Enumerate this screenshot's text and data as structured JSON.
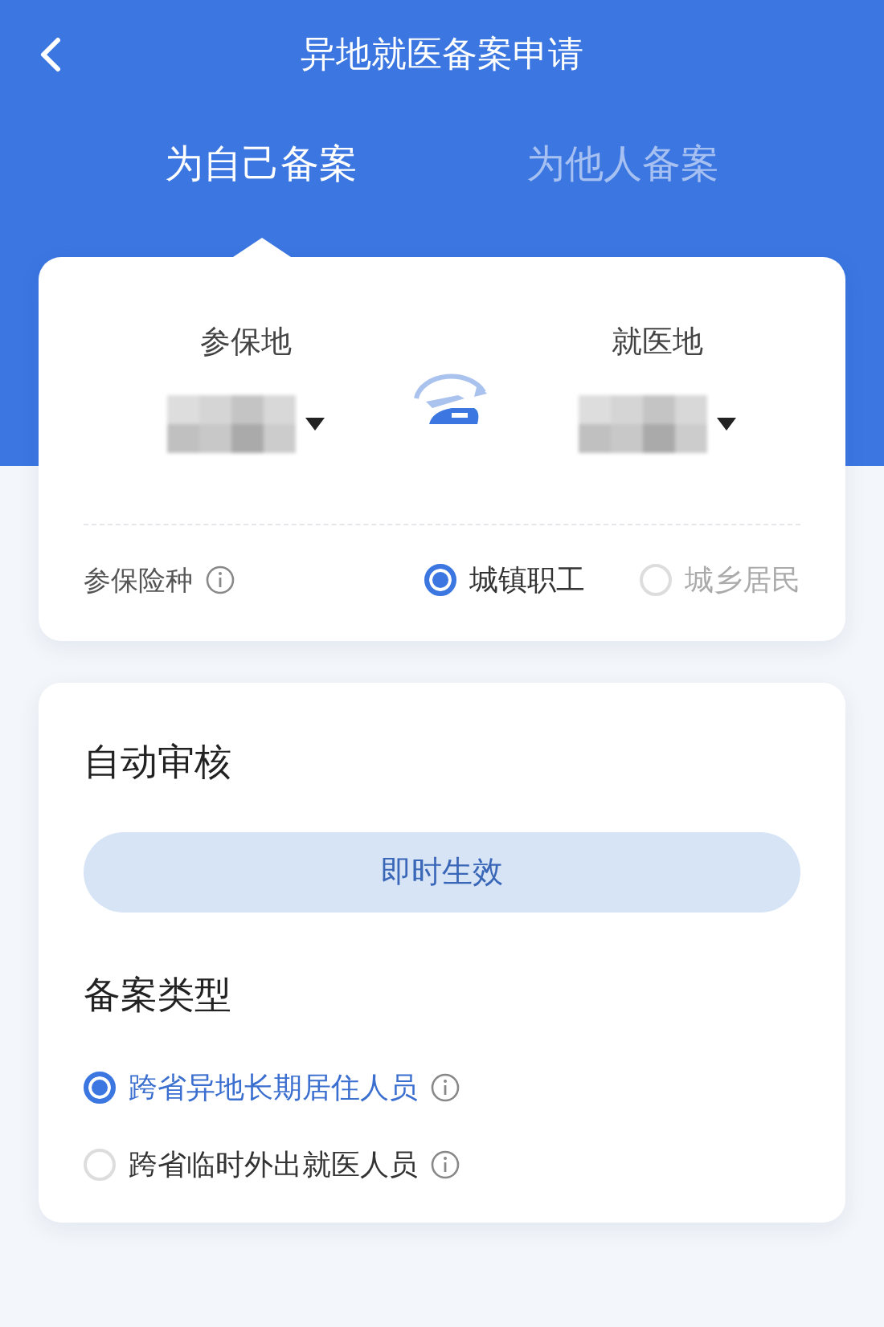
{
  "header": {
    "title": "异地就医备案申请"
  },
  "tabs": [
    {
      "label": "为自己备案",
      "selected": true
    },
    {
      "label": "为他人备案",
      "selected": false
    }
  ],
  "locations": [
    {
      "label": "参保地"
    },
    {
      "label": "就医地"
    }
  ],
  "insurance": {
    "label": "参保险种",
    "options": [
      {
        "label": "城镇职工",
        "selected": true
      },
      {
        "label": "城乡居民",
        "selected": false
      }
    ]
  },
  "review": {
    "title": "自动审核",
    "button": "即时生效"
  },
  "filing_type": {
    "title": "备案类型",
    "options": [
      {
        "label": "跨省异地长期居住人员",
        "selected": true
      },
      {
        "label": "跨省临时外出就医人员",
        "selected": false
      }
    ]
  }
}
